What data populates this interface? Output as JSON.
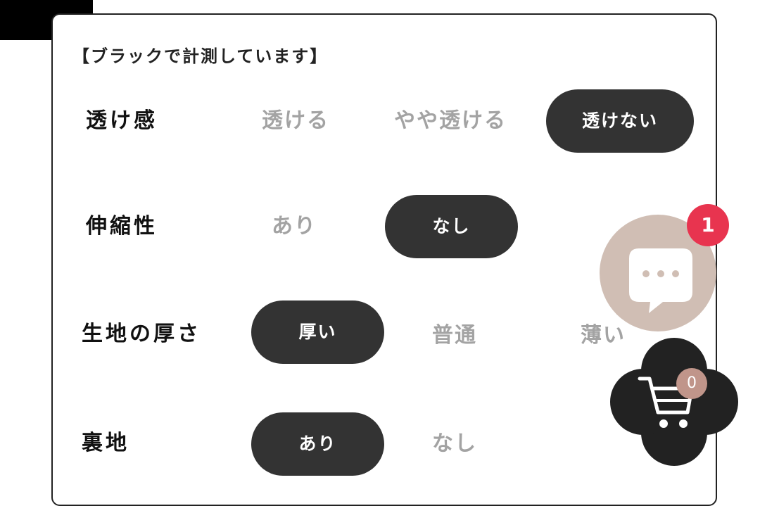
{
  "note": "【ブラックで計測しています】",
  "rows": [
    {
      "label": "透け感",
      "options": [
        {
          "label": "透ける",
          "selected": false
        },
        {
          "label": "やや透ける",
          "selected": false
        },
        {
          "label": "透けない",
          "selected": true
        }
      ]
    },
    {
      "label": "伸縮性",
      "options": [
        {
          "label": "あり",
          "selected": false
        },
        {
          "label": "なし",
          "selected": true
        }
      ]
    },
    {
      "label": "生地の厚さ",
      "options": [
        {
          "label": "厚い",
          "selected": true
        },
        {
          "label": "普通",
          "selected": false
        },
        {
          "label": "薄い",
          "selected": false
        }
      ]
    },
    {
      "label": "裏地",
      "options": [
        {
          "label": "あり",
          "selected": true
        },
        {
          "label": "なし",
          "selected": false
        }
      ]
    }
  ],
  "chat": {
    "icon": "chat-bubble-icon",
    "badge_count": "1",
    "badge_color": "#e8344f",
    "button_color": "#d0beb4"
  },
  "cart": {
    "icon": "cart-icon",
    "count": "0",
    "count_color": "#c0958a",
    "button_color": "#222222"
  },
  "colors": {
    "selected_bg": "#333333",
    "unselected_text": "#a3a3a3"
  }
}
